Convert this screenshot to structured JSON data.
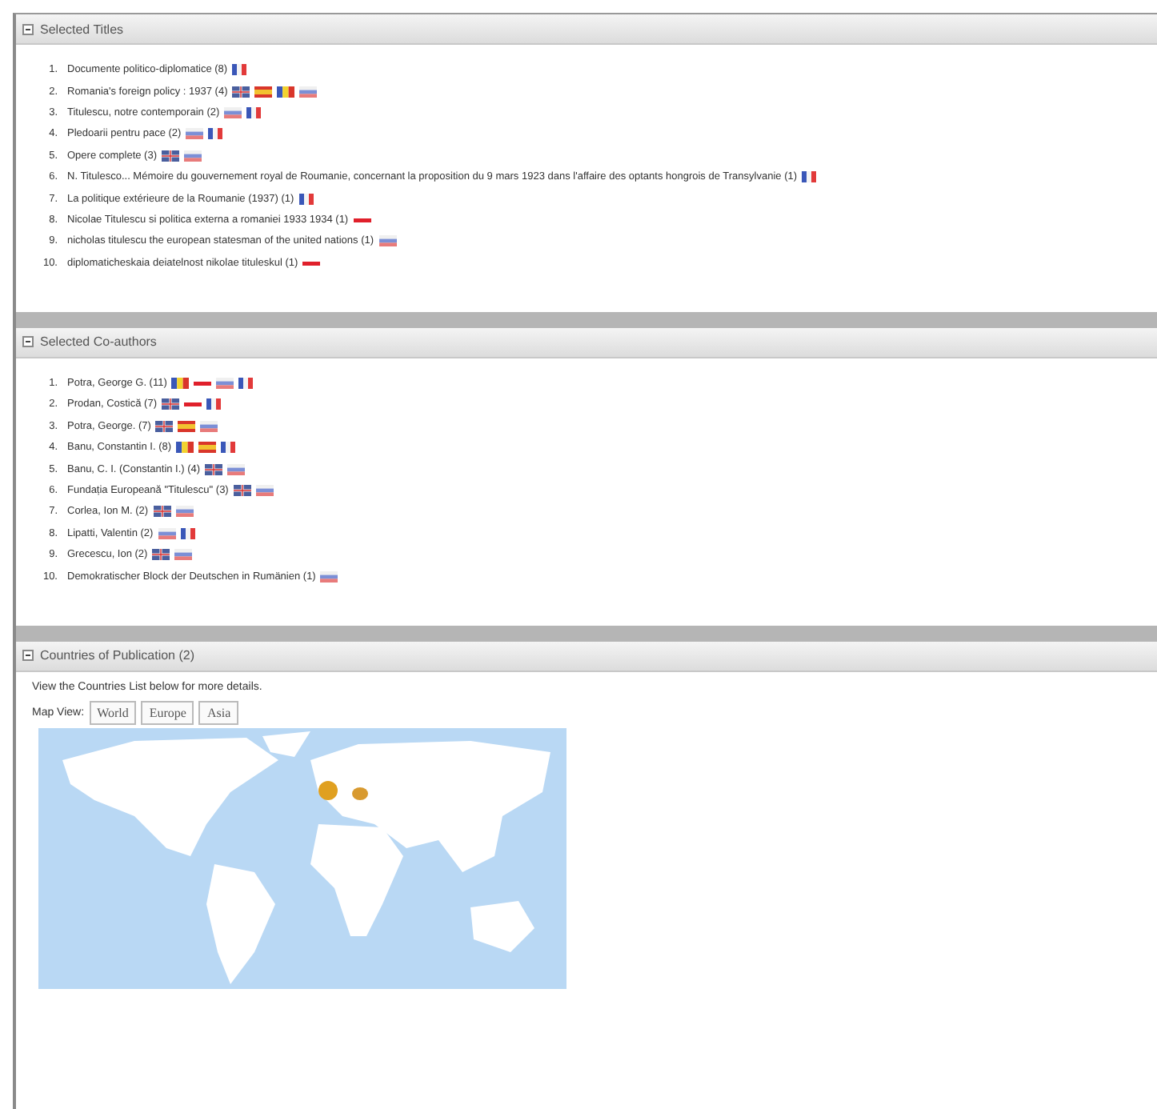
{
  "sections": [
    {
      "title": "Selected Titles",
      "expanded": true,
      "kind": "list",
      "items": [
        {
          "number": "1.",
          "text": "Documente politico-diplomatice (8)",
          "flags": [
            {
              "kind": "fr"
            }
          ]
        },
        {
          "number": "2.",
          "text": "Romania's foreign policy : 1937 (4)",
          "flags": [
            {
              "kind": "uk"
            },
            {
              "kind": "es"
            },
            {
              "kind": "ro"
            },
            {
              "kind": "ru"
            }
          ]
        },
        {
          "number": "3.",
          "text": "Titulescu, notre contemporain (2)",
          "flags": [
            {
              "kind": "ru"
            },
            {
              "kind": "fr"
            }
          ]
        },
        {
          "number": "4.",
          "text": "Pledoarii pentru pace (2)",
          "flags": [
            {
              "kind": "ru"
            },
            {
              "kind": "fr"
            }
          ]
        },
        {
          "number": "5.",
          "text": "Opere complete (3)",
          "flags": [
            {
              "kind": "uk"
            },
            {
              "kind": "ru"
            }
          ]
        },
        {
          "number": "6.",
          "text": "N. Titulesco... Mémoire du gouvernement royal de Roumanie, concernant la proposition du 9 mars 1923 dans l'affaire des optants hongrois de Transylvanie (1)",
          "flags": [
            {
              "kind": "fr"
            }
          ]
        },
        {
          "number": "7.",
          "text": "La politique extérieure de la Roumanie (1937) (1)",
          "flags": [
            {
              "kind": "fr"
            }
          ]
        },
        {
          "number": "8.",
          "text": "Nicolae Titulescu si politica externa a romaniei 1933 1934 (1)",
          "flags": [
            {
              "kind": "dash"
            }
          ]
        },
        {
          "number": "9.",
          "text": "nicholas titulescu the european statesman of the united nations (1)",
          "flags": [
            {
              "kind": "ru"
            }
          ]
        },
        {
          "number": "10.",
          "text": "diplomaticheskaia deiatelnost nikolae tituleskul (1)",
          "flags": [
            {
              "kind": "dash"
            }
          ]
        }
      ]
    },
    {
      "title": "Selected Co-authors",
      "expanded": true,
      "kind": "list",
      "items": [
        {
          "number": "1.",
          "text": "Potra, George G. (11)",
          "flags": [
            {
              "kind": "ro"
            },
            {
              "kind": "dash"
            },
            {
              "kind": "ru"
            },
            {
              "kind": "fr"
            }
          ]
        },
        {
          "number": "2.",
          "text": "Prodan, Costică (7)",
          "flags": [
            {
              "kind": "uk"
            },
            {
              "kind": "dash"
            },
            {
              "kind": "fr"
            }
          ]
        },
        {
          "number": "3.",
          "text": "Potra, George. (7)",
          "flags": [
            {
              "kind": "uk"
            },
            {
              "kind": "es"
            },
            {
              "kind": "ru"
            }
          ]
        },
        {
          "number": "4.",
          "text": "Banu, Constantin I. (8)",
          "flags": [
            {
              "kind": "ro"
            },
            {
              "kind": "es"
            },
            {
              "kind": "fr"
            }
          ]
        },
        {
          "number": "5.",
          "text": "Banu, C. I. (Constantin I.) (4)",
          "flags": [
            {
              "kind": "uk"
            },
            {
              "kind": "ru"
            }
          ]
        },
        {
          "number": "6.",
          "text": "Fundația Europeană \"Titulescu\" (3)",
          "flags": [
            {
              "kind": "uk"
            },
            {
              "kind": "ru"
            }
          ]
        },
        {
          "number": "7.",
          "text": "Corlea, Ion M. (2)",
          "flags": [
            {
              "kind": "uk"
            },
            {
              "kind": "ru"
            }
          ]
        },
        {
          "number": "8.",
          "text": "Lipatti, Valentin (2)",
          "flags": [
            {
              "kind": "ru"
            },
            {
              "kind": "fr"
            }
          ]
        },
        {
          "number": "9.",
          "text": "Grecescu, Ion (2)",
          "flags": [
            {
              "kind": "uk"
            },
            {
              "kind": "ru"
            }
          ]
        },
        {
          "number": "10.",
          "text": "Demokratischer Block der Deutschen in Rumänien (1)",
          "flags": [
            {
              "kind": "ru"
            }
          ]
        }
      ]
    },
    {
      "title": "Countries of Publication (2)",
      "expanded": true,
      "kind": "map",
      "note": "View the Countries List below for more details.",
      "map_view_label": "Map View:",
      "buttons": [
        "World",
        "Europe",
        "Asia"
      ]
    }
  ]
}
